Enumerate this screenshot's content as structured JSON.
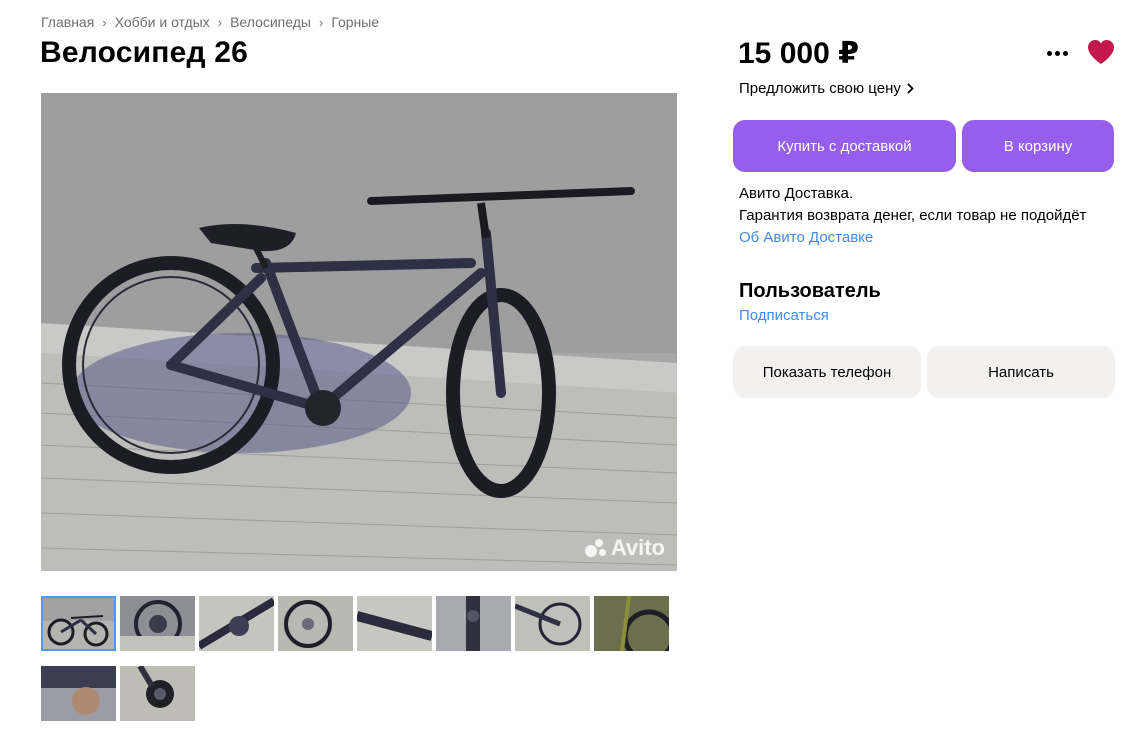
{
  "breadcrumb": [
    {
      "label": "Главная"
    },
    {
      "label": "Хобби и отдых"
    },
    {
      "label": "Велосипеды"
    },
    {
      "label": "Горные"
    }
  ],
  "title": "Велосипед 26",
  "price": "15 000 ₽",
  "offer_price": "Предложить свою цену",
  "buttons": {
    "buy_delivery": "Купить с доставкой",
    "cart": "В корзину",
    "show_phone": "Показать телефон",
    "write": "Написать"
  },
  "delivery": {
    "line1": "Авито Доставка.",
    "line2": "Гарантия возврата денег, если товар не подойдёт",
    "link": "Об Авито Доставке"
  },
  "seller": {
    "name": "Пользователь",
    "subscribe": "Подписаться"
  },
  "photo": {
    "watermark": "Avito",
    "thumbnail_count": 10,
    "active_thumbnail": 0
  },
  "colors": {
    "accent": "#965eeb",
    "link": "#3e8cf0",
    "favorite": "#c4184d",
    "secondary_button": "#f2f1f0"
  },
  "icons": {
    "breadcrumb_separator": "chevron-right-icon",
    "more": "more-dots-icon",
    "favorite": "heart-icon",
    "offer_arrow": "chevron-right-icon"
  }
}
